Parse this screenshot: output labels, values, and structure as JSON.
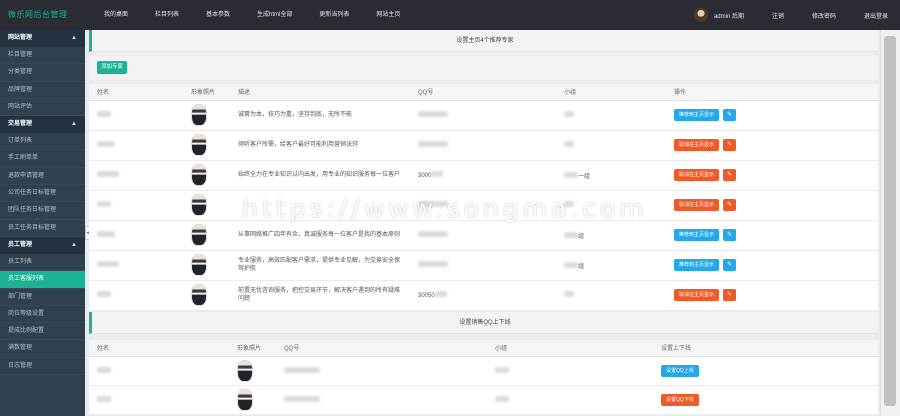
{
  "brand": "微乐网后台管理",
  "top_nav": [
    "我的桌面",
    "栏目列表",
    "基本参数",
    "生成html全部",
    "更新当列表",
    "网站主页"
  ],
  "top_right": {
    "user": "admin 后期",
    "logout": "注销",
    "change_password": "修改密码",
    "exit": "退出登录"
  },
  "sidebar": {
    "groups": [
      {
        "label": "网站管理",
        "items": [
          "栏目管理",
          "分类管理",
          "品牌管理",
          "网站评估"
        ]
      },
      {
        "label": "交易管理",
        "items": [
          "订单列表",
          "手工刷单单",
          "退款申请管理",
          "公司任务日标管理",
          "团队任务日标管理",
          "员工任务目标管理"
        ]
      },
      {
        "label": "员工管理",
        "items": [
          "员工列表",
          "员工客服列表",
          "部门管理",
          "岗位等级设置",
          "提成比例配置",
          "满数管理",
          "日志管理"
        ]
      }
    ],
    "active_item": "员工客服列表"
  },
  "panel1": {
    "title": "设置主页4个推荐专家",
    "add_button": "添加专家",
    "columns": [
      "姓名",
      "形象照片",
      "描述",
      "QQ号",
      "小组",
      "操作"
    ],
    "rows": [
      {
        "desc": "诚實为本，技巧为重，坚持到底，无所不能",
        "qq": "",
        "group": "",
        "action": "推荐到主页显示",
        "color": "blue"
      },
      {
        "desc": "倾听客户所需，给客户最好可能利用营销诀窍",
        "qq": "",
        "group": "",
        "action": "取消在主页显示",
        "color": "orange"
      },
      {
        "desc": "始终全力在专业知识以内出发，用专业的知识服务每一位客户",
        "qq": "3000",
        "group": "一组",
        "action": "取消在主页显示",
        "color": "orange"
      },
      {
        "desc": "",
        "qq": "",
        "group": "",
        "action": "取消在主页显示",
        "color": "orange"
      },
      {
        "desc": "从事网络推广四年有余，真诚服务每一位客户是我的基本原则",
        "qq": "",
        "group": "组",
        "action": "推荐到主页显示",
        "color": "blue"
      },
      {
        "desc": "专业服务，高效匹配客户需求，提供专业见解，为交易安全保驾护航",
        "qq": "",
        "group": "组",
        "action": "推荐到主页显示",
        "color": "blue"
      },
      {
        "desc": "前置无忧咨询服务，把控交易环节，解决客户遇到的所有疑难问题",
        "qq": "30050",
        "group": "",
        "action": "取消在主页显示",
        "color": "orange"
      }
    ]
  },
  "panel2": {
    "title": "设置销售QQ上下线",
    "columns": [
      "姓名",
      "形象照片",
      "QQ号",
      "小组",
      "设置上下线"
    ],
    "rows": [
      {
        "action": "设置QQ上线",
        "color": "blue"
      },
      {
        "action": "设置QQ下线",
        "color": "orange"
      }
    ]
  },
  "watermark": "https://www.songma.com",
  "colors": {
    "accent": "#1ab394",
    "sidebar": "#2f4050",
    "topbar": "#2b2b34",
    "blue_button": "#23a8e8",
    "orange_button": "#f05a26"
  }
}
